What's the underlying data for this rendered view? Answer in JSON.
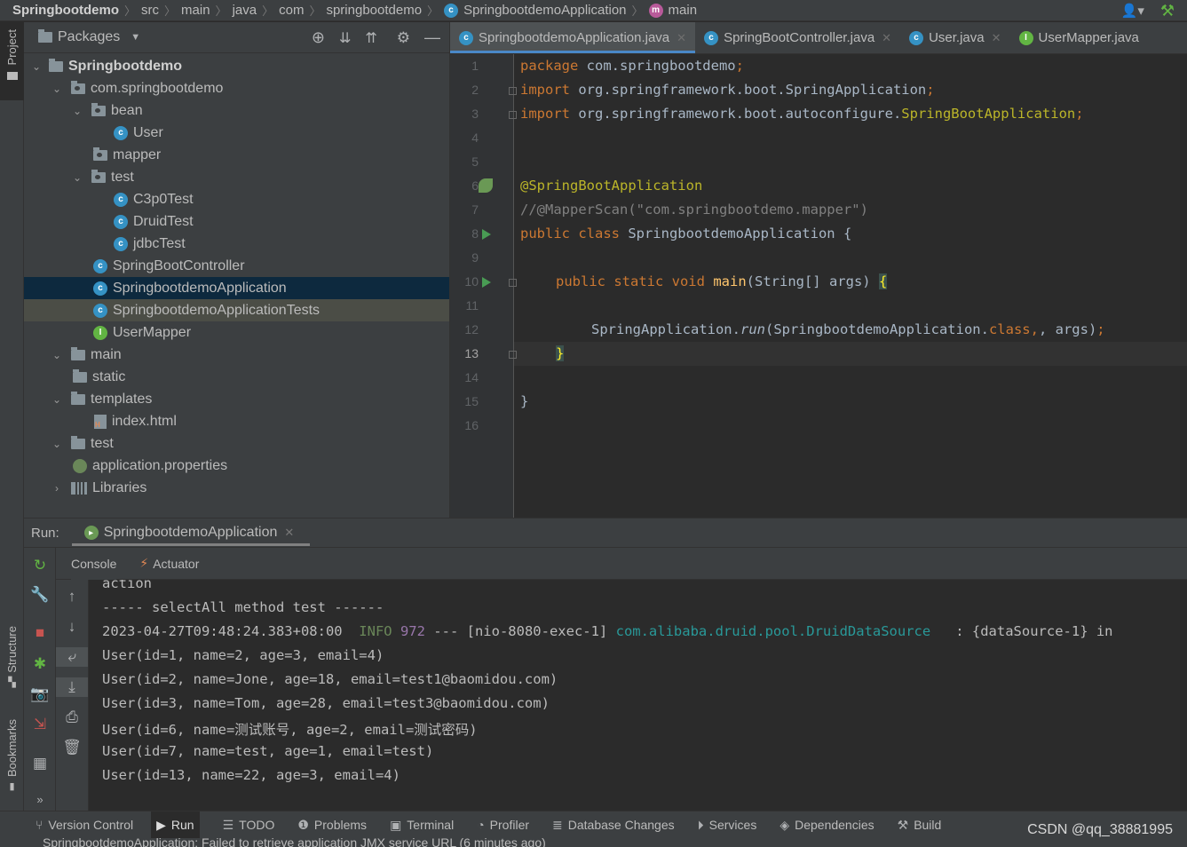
{
  "breadcrumb": [
    "Springbootdemo",
    "src",
    "main",
    "java",
    "com",
    "springbootdemo",
    "SpringbootdemoApplication",
    "main"
  ],
  "project_panel": {
    "title": "Packages",
    "tree": [
      {
        "label": "Springbootdemo",
        "icon": "module-folder-icon",
        "expanded": true,
        "bold": true
      },
      {
        "label": "com.springbootdemo",
        "icon": "package-icon",
        "expanded": true
      },
      {
        "label": "bean",
        "icon": "package-icon",
        "expanded": true
      },
      {
        "label": "User",
        "icon": "class-icon"
      },
      {
        "label": "mapper",
        "icon": "package-icon"
      },
      {
        "label": "test",
        "icon": "package-icon",
        "expanded": true
      },
      {
        "label": "C3p0Test",
        "icon": "test-class-icon"
      },
      {
        "label": "DruidTest",
        "icon": "test-class-icon"
      },
      {
        "label": "jdbcTest",
        "icon": "test-class-icon"
      },
      {
        "label": "SpringBootController",
        "icon": "class-icon"
      },
      {
        "label": "SpringbootdemoApplication",
        "icon": "spring-class-icon",
        "selected": true
      },
      {
        "label": "SpringbootdemoApplicationTests",
        "icon": "class-icon"
      },
      {
        "label": "UserMapper",
        "icon": "interface-icon"
      },
      {
        "label": "main",
        "icon": "folder-icon",
        "expanded": true
      },
      {
        "label": "static",
        "icon": "folder-icon"
      },
      {
        "label": "templates",
        "icon": "folder-icon",
        "expanded": true
      },
      {
        "label": "index.html",
        "icon": "html-file-icon"
      },
      {
        "label": "test",
        "icon": "folder-icon",
        "expanded": true
      },
      {
        "label": "application.properties",
        "icon": "properties-file-icon"
      },
      {
        "label": "Libraries",
        "icon": "libraries-icon",
        "collapsed": true
      }
    ]
  },
  "editor_tabs": [
    {
      "label": "SpringbootdemoApplication.java",
      "active": true
    },
    {
      "label": "SpringBootController.java"
    },
    {
      "label": "User.java"
    },
    {
      "label": "UserMapper.java"
    }
  ],
  "code": {
    "line_numbers": [
      "1",
      "2",
      "3",
      "4",
      "5",
      "6",
      "7",
      "8",
      "9",
      "10",
      "11",
      "12",
      "13",
      "14",
      "15",
      "16"
    ],
    "current_line": "13",
    "lines": {
      "l1_kw": "package",
      "l1_rest": " com.springbootdemo",
      "l1_semi": ";",
      "l2_kw": "import",
      "l2_rest": " org.springframework.boot.SpringApplication",
      "l2_semi": ";",
      "l3_kw": "import",
      "l3_rest": " org.springframework.boot.autoconfigure.",
      "l3_ann": "SpringBootApplication",
      "l3_semi": ";",
      "l6_ann": "@SpringBootApplication",
      "l7_cmt": "//@MapperScan(\"com.springbootdemo.mapper\")",
      "l8_kw": "public class",
      "l8_rest": " SpringbootdemoApplication {",
      "l10_kw": "public static void",
      "l10_fn": "main",
      "l10_rest": "(String[] args) ",
      "l10_brace": "{",
      "l12_a": "SpringApplication.",
      "l12_run": "run",
      "l12_b": "(SpringbootdemoApplication.",
      "l12_cls": "class",
      "l12_c": ", args)",
      "l12_semi": ";",
      "l13_brace": "}",
      "l15_brace": "}"
    }
  },
  "run_panel": {
    "label": "Run:",
    "tab": "SpringbootdemoApplication",
    "subtabs": [
      "Console",
      "Actuator"
    ],
    "console": {
      "l0": "action",
      "l1": "----- selectAll method test ------",
      "l2_time": "2023-04-27T09:48:24.383+08:00",
      "l2_level": "INFO",
      "l2_pid": "972",
      "l2_mid": " --- [nio-8080-exec-1] ",
      "l2_logger": "com.alibaba.druid.pool.DruidDataSource",
      "l2_msg": "   : {dataSource-1} in",
      "l3": "User(id=1, name=2, age=3, email=4)",
      "l4": "User(id=2, name=Jone, age=18, email=test1@baomidou.com)",
      "l5": "User(id=3, name=Tom, age=28, email=test3@baomidou.com)",
      "l6": "User(id=6, name=测试账号, age=2, email=测试密码)",
      "l7": "User(id=7, name=test, age=1, email=test)",
      "l8": "User(id=13, name=22, age=3, email=4)"
    }
  },
  "left_strip": {
    "project": "Project",
    "structure": "Structure",
    "bookmarks": "Bookmarks"
  },
  "bottom_bar": [
    {
      "label": "Version Control",
      "icon": "version-control-icon"
    },
    {
      "label": "Run",
      "icon": "run-icon",
      "active": true
    },
    {
      "label": "TODO",
      "icon": "todo-icon"
    },
    {
      "label": "Problems",
      "icon": "problems-icon"
    },
    {
      "label": "Terminal",
      "icon": "terminal-icon"
    },
    {
      "label": "Profiler",
      "icon": "profiler-icon"
    },
    {
      "label": "Database Changes",
      "icon": "database-changes-icon"
    },
    {
      "label": "Services",
      "icon": "services-icon"
    },
    {
      "label": "Dependencies",
      "icon": "dependencies-icon"
    },
    {
      "label": "Build",
      "icon": "build-icon"
    }
  ],
  "watermark": "CSDN @qq_38881995",
  "status": "SpringbootdemoApplication: Failed to retrieve application JMX service URL (6 minutes ago)"
}
